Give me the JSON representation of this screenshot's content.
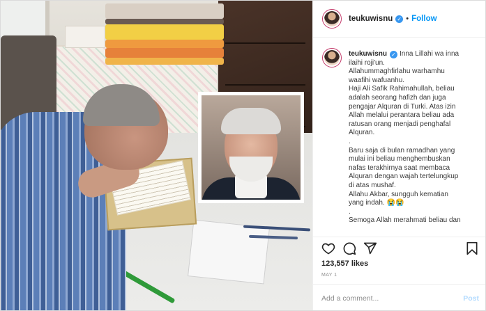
{
  "header": {
    "username": "teukuwisnu",
    "separator": "•",
    "follow_label": "Follow"
  },
  "caption": {
    "username": "teukuwisnu",
    "lines": [
      "Inna Lillahi wa inna",
      "ilaihi roji'un.",
      "Allahummaghfirlahu warhamhu",
      "waafihi wafuanhu.",
      "Haji Ali Safik Rahimahullah, beliau",
      "adalah seorang hafizh dan juga",
      "pengajar Alquran di Turki. Atas izin",
      "Allah melalui perantara beliau ada",
      "ratusan orang menjadi penghafal",
      "Alquran.",
      ".",
      "Baru saja di bulan ramadhan yang",
      "mulai ini beliau menghembuskan",
      "nafas terakhirnya saat membaca",
      "Alquran dengan wajah tertelungkup",
      "di atas mushaf.",
      "Allahu Akbar, sungguh kematian",
      "yang indah. 😭😭",
      ".",
      "Semoga Allah merahmati beliau dan"
    ]
  },
  "actions": {
    "icons": [
      "heart-icon",
      "comment-icon",
      "share-icon",
      "bookmark-icon"
    ]
  },
  "likes_label": "123,557 likes",
  "date_label": "MAY 1",
  "comment": {
    "placeholder": "Add a comment...",
    "post_label": "Post"
  },
  "colors": {
    "accent": "#0095f6",
    "verified": "#3897f0",
    "post_disabled": "#b3dbff"
  }
}
